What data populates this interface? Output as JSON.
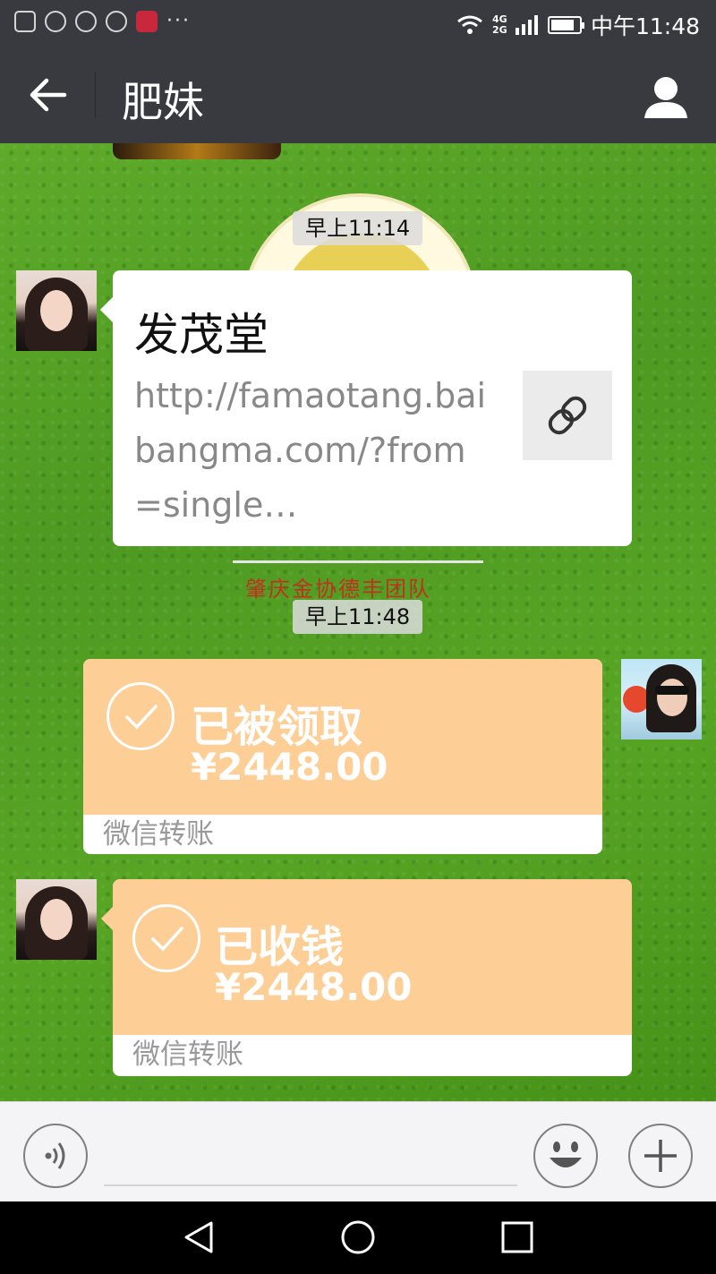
{
  "status_bar": {
    "time": "中午11:48",
    "network": "4G 2G",
    "battery_level": 0.85
  },
  "header": {
    "title": "肥妹"
  },
  "chat": {
    "messages": [
      {
        "type": "timestamp",
        "text": "早上11:14"
      },
      {
        "type": "link",
        "sender": "other",
        "title": "发茂堂",
        "url": "http://famaotang.baibangma.com/?from=single…"
      },
      {
        "type": "sticker_caption",
        "text": "肇庆金协德丰团队"
      },
      {
        "type": "timestamp",
        "text": "早上11:48"
      },
      {
        "type": "transfer",
        "sender": "me",
        "status": "已被领取",
        "amount": "¥2448.00",
        "footer": "微信转账"
      },
      {
        "type": "transfer",
        "sender": "other",
        "status": "已收钱",
        "amount": "¥2448.00",
        "footer": "微信转账"
      }
    ]
  },
  "colors": {
    "header_bg": "#393a3f",
    "transfer_bg": "#fdcf97",
    "chat_bg": "#52a024"
  }
}
